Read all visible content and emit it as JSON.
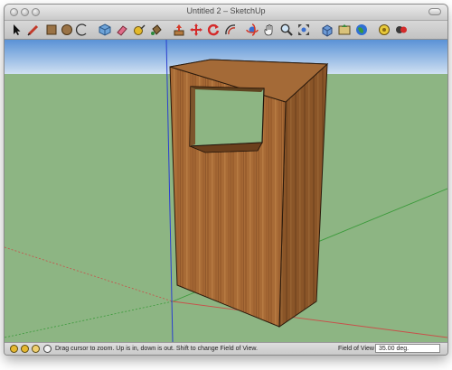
{
  "window": {
    "title": "Untitled 2 – SketchUp"
  },
  "toolbar": {
    "tools": [
      {
        "icon": "select-arrow-icon"
      },
      {
        "icon": "pencil-line-icon"
      },
      {
        "icon": "rectangle-icon"
      },
      {
        "icon": "circle-icon"
      },
      {
        "icon": "arc-icon"
      },
      {
        "icon": "make-component-icon"
      },
      {
        "icon": "eraser-icon"
      },
      {
        "icon": "tape-measure-icon"
      },
      {
        "icon": "paint-bucket-icon"
      },
      {
        "icon": "push-pull-icon"
      },
      {
        "icon": "move-icon"
      },
      {
        "icon": "rotate-icon"
      },
      {
        "icon": "offset-icon"
      },
      {
        "icon": "orbit-icon"
      },
      {
        "icon": "pan-icon"
      },
      {
        "icon": "zoom-icon"
      },
      {
        "icon": "zoom-extents-icon"
      },
      {
        "icon": "get-models-icon"
      },
      {
        "icon": "share-model-icon"
      },
      {
        "icon": "google-earth-icon"
      },
      {
        "icon": "components-icon"
      },
      {
        "icon": "model-info-icon"
      }
    ]
  },
  "status": {
    "message": "Drag cursor to zoom.  Up is in, down is out. Shift to change Field of View.",
    "vcb_label": "Field of View",
    "vcb_value": "35.00 deg."
  },
  "colors": {
    "sky_top": "#5a92d6",
    "sky_bottom": "#cfe0f2",
    "ground": "#8db583",
    "wood": "#a46a37",
    "axis_red": "#c8504a",
    "axis_green": "#3a9a3a",
    "axis_blue": "#2a3fd0"
  }
}
